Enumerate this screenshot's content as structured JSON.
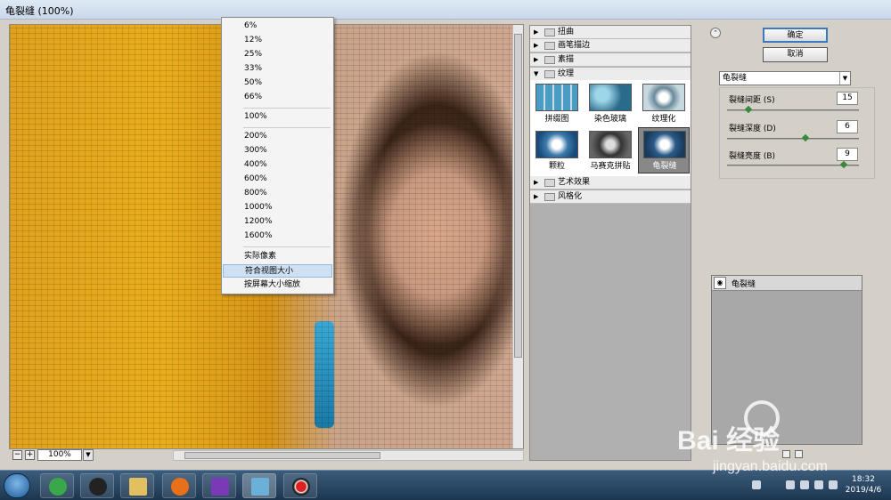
{
  "window": {
    "title": "龟裂缝 (100%)"
  },
  "preview": {
    "zoom": "100%",
    "zoom_minus": "−",
    "zoom_plus": "+"
  },
  "zoom_menu": {
    "items": [
      "6%",
      "12%",
      "25%",
      "33%",
      "50%",
      "66%",
      "100%",
      "200%",
      "300%",
      "400%",
      "600%",
      "800%",
      "1000%",
      "1200%",
      "1600%",
      "实际像素",
      "符合视图大小",
      "按屏幕大小缩放"
    ],
    "highlighted": "符合视图大小"
  },
  "gallery": {
    "categories": [
      {
        "label": "扭曲"
      },
      {
        "label": "画笔描边"
      },
      {
        "label": "素描"
      },
      {
        "label": "纹理"
      },
      {
        "label": "艺术效果"
      },
      {
        "label": "风格化"
      }
    ],
    "texture_filters": [
      "拼缀图",
      "染色玻璃",
      "纹理化",
      "颗粒",
      "马赛克拼贴",
      "龟裂缝"
    ],
    "selected": "龟裂缝"
  },
  "panel": {
    "ok": "确定",
    "cancel": "取消",
    "filter_select": "龟裂缝",
    "params": [
      {
        "label": "裂缝间距 (S)",
        "value": "15",
        "fraction": 0.15
      },
      {
        "label": "裂缝深度 (D)",
        "value": "6",
        "fraction": 0.6
      },
      {
        "label": "裂缝亮度 (B)",
        "value": "9",
        "fraction": 0.9
      }
    ],
    "layer": "龟裂缝"
  },
  "taskbar": {
    "time": "18:32",
    "date": "2019/4/6"
  },
  "watermark": {
    "line1": "Bai 经验",
    "line2": "jingyan.baidu.com"
  },
  "colors": {
    "accent": "#3a78c4",
    "taskbar": "#1d3650"
  }
}
